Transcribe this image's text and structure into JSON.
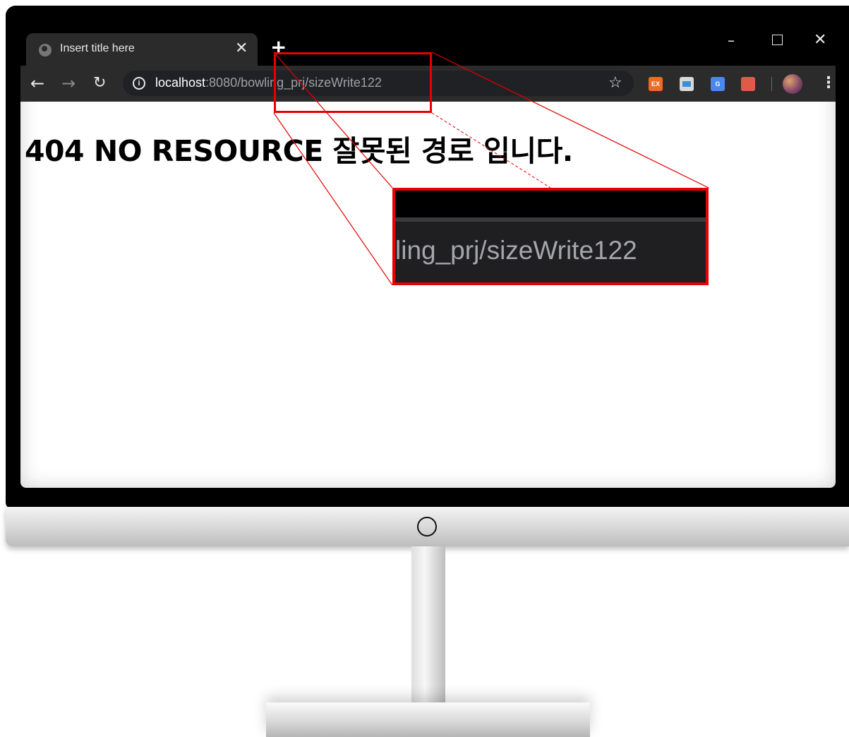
{
  "browser": {
    "tab": {
      "title": "Insert title here",
      "close_glyph": "✕"
    },
    "new_tab_glyph": "+",
    "window_controls": {
      "minimize": "–",
      "maximize": "",
      "close": "✕"
    },
    "nav": {
      "back": "←",
      "forward": "→",
      "reload": "↻"
    },
    "address": {
      "info_glyph": "i",
      "host": "localhost",
      "path": ":8080/bowling_prj/sizeWrite122"
    },
    "star_glyph": "☆",
    "extensions": [
      {
        "icon": "ex-extension-icon",
        "label": "EX",
        "color": "#f06a22"
      },
      {
        "icon": "window-extension-icon",
        "label": "",
        "color": "#d8d8d8"
      },
      {
        "icon": "translate-extension-icon",
        "label": "G",
        "color": "#4a88ef"
      },
      {
        "icon": "badge-extension-icon",
        "label": "",
        "color": "#e05a4a"
      }
    ],
    "menu_glyph": "⋮"
  },
  "page": {
    "heading": "404 NO RESOURCE 잘못된 경로 입니다."
  },
  "zoom_callout": {
    "text": "ling_prj/sizeWrite122",
    "color": "#e60000"
  }
}
